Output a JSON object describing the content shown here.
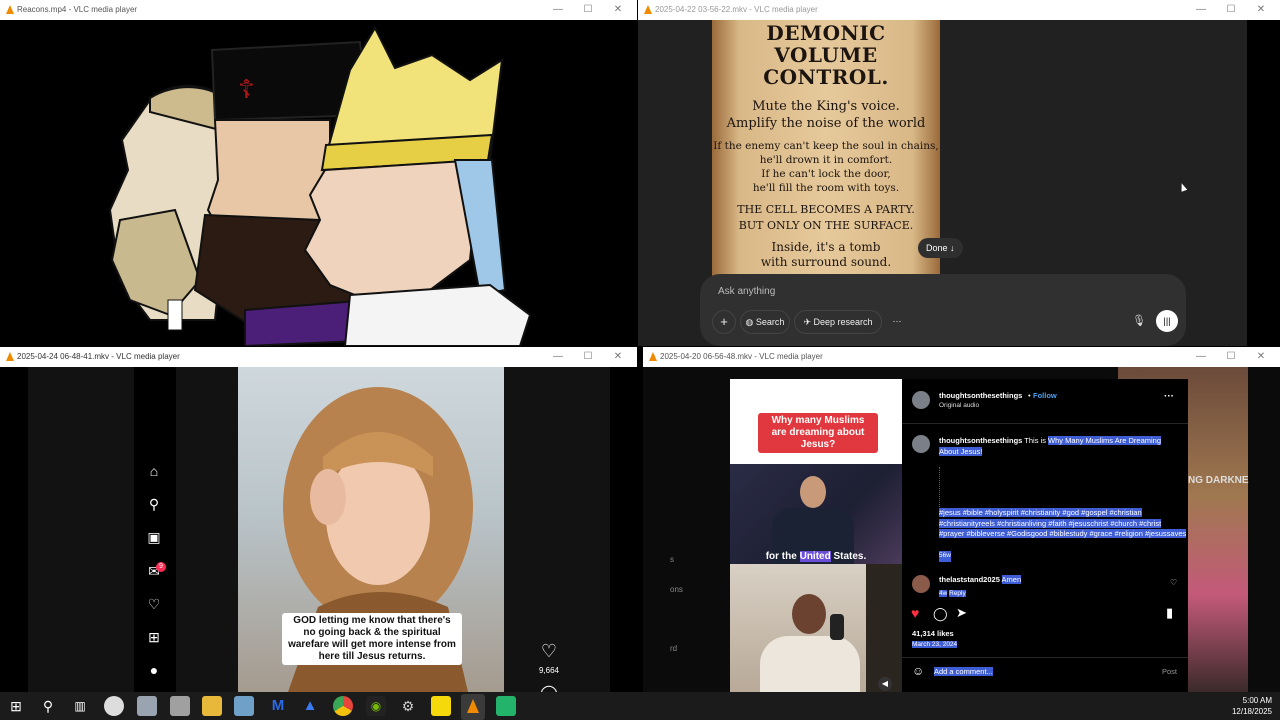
{
  "windows": {
    "w1": {
      "title": "Reacons.mp4 - VLC media player"
    },
    "w2": {
      "title": "2025-04-22 03-56-22.mkv - VLC media player"
    },
    "w3": {
      "title": "2025-04-24 06-48-41.mkv - VLC media player"
    },
    "w4": {
      "title": "2025-04-20 06-56-48.mkv - VLC media player"
    }
  },
  "window_controls": {
    "minimize": "—",
    "maximize": "☐",
    "close": "✕"
  },
  "poster": {
    "heading_lines": [
      "DEMONIC",
      "VOLUME",
      "CONTROL."
    ],
    "para1": [
      "Mute the King's voice.",
      "Amplify the noise of the world"
    ],
    "para2": [
      "If the enemy can't keep the soul in chains,",
      "he'll drown it in comfort.",
      "If he can't lock the door,",
      "he'll fill the room with toys."
    ],
    "para3": [
      "THE CELL BECOMES A PARTY.",
      "BUT ONLY ON THE SURFACE."
    ],
    "para4": [
      "Inside, it's a tomb",
      "with surround sound."
    ]
  },
  "chatgpt": {
    "done_label": "Done ↓",
    "input_placeholder": "Ask anything",
    "plus": "+",
    "search_label": "Search",
    "deep_research_label": "Deep research",
    "more": "···"
  },
  "tiktok": {
    "caption": "GOD letting me know that there's no going back & the spiritual warefare will get more intense from here till Jesus returns.",
    "like_count": "9,664",
    "notif_badge": "9"
  },
  "instagram": {
    "video_caption": "Why many Muslims are dreaming about Jesus?",
    "subtitle_prefix": "for the ",
    "subtitle_hl": "United",
    "subtitle_suffix": " States.",
    "username": "thoughtsonthesethings",
    "follow": "Follow",
    "audio": "Original audio",
    "post_prefix": "This is ",
    "post_title": "Why Many Muslims Are Dreaming About Jesus!",
    "hashtags": "#jesus #bible #holyspirit #christianity #god #gospel #christian #christianityreels #christianliving #faith #jesuschrist #church #christ #prayer #bibleverse #Godisgood #biblestudy #grace #religion #jesussaves",
    "post_age": "56w",
    "comment_user": "thelaststand2025",
    "comment_text": "Amen",
    "comment_age": "4w",
    "reply": "Reply",
    "likes": "41,314 likes",
    "date": "March 23, 2024",
    "add_comment": "Add a comment...",
    "post_btn": "Post",
    "right_overlay": "NG DARKNE",
    "left_fragments": [
      "s",
      "ons",
      "rd"
    ]
  },
  "taskbar": {
    "time": "5:00 AM",
    "date": "12/18/2025"
  },
  "colors": {
    "vlc_orange": "#f08a00",
    "ig_blue": "#3f5ed6",
    "caption_red": "#e0383e",
    "chat_bg": "#212121"
  }
}
